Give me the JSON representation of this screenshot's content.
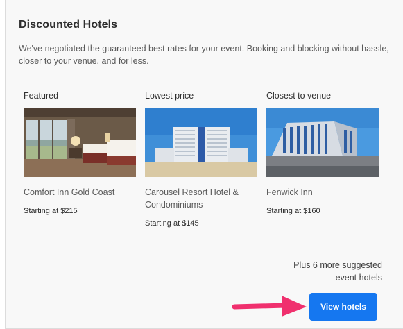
{
  "section": {
    "title": "Discounted Hotels",
    "description": "We've negotiated the guaranteed best rates for your event. Booking and blocking without hassle, closer to your venue, and for less."
  },
  "hotels": [
    {
      "category": "Featured",
      "name": "Comfort Inn Gold Coast",
      "price": "Starting at $215"
    },
    {
      "category": "Lowest price",
      "name": "Carousel Resort Hotel & Condominiums",
      "price": "Starting at $145"
    },
    {
      "category": "Closest to venue",
      "name": "Fenwick Inn",
      "price": "Starting at $160"
    }
  ],
  "footer": {
    "more_text": "Plus 6 more suggested event hotels",
    "button_label": "View hotels"
  },
  "colors": {
    "button": "#1577f0",
    "arrow": "#f0306e"
  }
}
